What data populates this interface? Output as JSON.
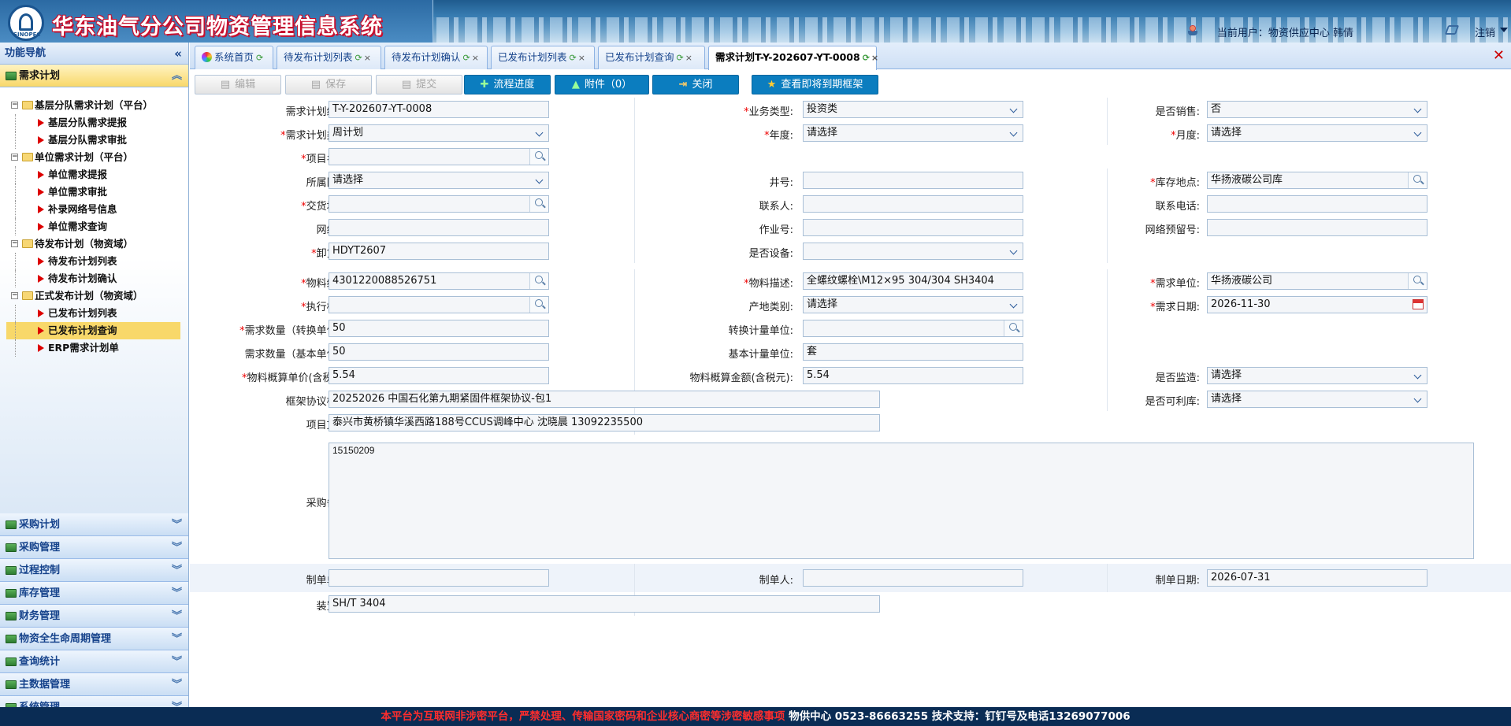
{
  "header": {
    "system_title": "华东油气分公司物资管理信息系统",
    "user_label": "当前用户：物资供应中心 韩倩",
    "logout_label": "注销",
    "logo_text": "SINOPEC"
  },
  "sidebar": {
    "title": "功能导航",
    "active_section": "需求计划",
    "tree": [
      {
        "type": "folder",
        "label": "基层分队需求计划（平台）"
      },
      {
        "type": "leaf",
        "label": "基层分队需求提报"
      },
      {
        "type": "leaf",
        "label": "基层分队需求审批"
      },
      {
        "type": "folder",
        "label": "单位需求计划（平台）"
      },
      {
        "type": "leaf",
        "label": "单位需求提报"
      },
      {
        "type": "leaf",
        "label": "单位需求审批"
      },
      {
        "type": "leaf",
        "label": "补录网络号信息"
      },
      {
        "type": "leaf",
        "label": "单位需求查询"
      },
      {
        "type": "folder",
        "label": "待发布计划（物资域）"
      },
      {
        "type": "leaf",
        "label": "待发布计划列表"
      },
      {
        "type": "leaf",
        "label": "待发布计划确认"
      },
      {
        "type": "folder",
        "label": "正式发布计划（物资域）"
      },
      {
        "type": "leaf",
        "label": "已发布计划列表"
      },
      {
        "type": "leaf",
        "label": "已发布计划查询",
        "selected": true
      },
      {
        "type": "leaf",
        "label": "ERP需求计划单"
      }
    ],
    "sections": [
      "采购计划",
      "采购管理",
      "过程控制",
      "库存管理",
      "财务管理",
      "物资全生命周期管理",
      "查询统计",
      "主数据管理",
      "系统管理"
    ]
  },
  "tabs": [
    {
      "label": "系统首页",
      "home": true
    },
    {
      "label": "待发布计划列表"
    },
    {
      "label": "待发布计划确认"
    },
    {
      "label": "已发布计划列表"
    },
    {
      "label": "已发布计划查询"
    },
    {
      "label": "需求计划T-Y-202607-YT-0008",
      "active": true
    }
  ],
  "toolbar": {
    "edit": "编辑",
    "save": "保存",
    "submit": "提交",
    "flow": "流程进度",
    "attach": "附件（0）",
    "close": "关闭",
    "expiring": "查看即将到期框架"
  },
  "form": {
    "plan_no": {
      "label": "需求计划编号:",
      "value": "T-Y-202607-YT-0008"
    },
    "biz_type": {
      "label": "业务类型:",
      "value": "投资类"
    },
    "is_sale": {
      "label": "是否销售:",
      "value": "否"
    },
    "plan_type": {
      "label": "需求计划类型:",
      "value": "周计划"
    },
    "year": {
      "label": "年度:",
      "value": "请选择"
    },
    "month": {
      "label": "月度:",
      "value": "请选择"
    },
    "project_name": {
      "label": "项目名称:",
      "value": ""
    },
    "region": {
      "label": "所属区域:",
      "value": "请选择"
    },
    "well_no": {
      "label": "井号:",
      "value": ""
    },
    "stock_loc": {
      "label": "库存地点:",
      "value": "华扬液碳公司库"
    },
    "delivery_addr": {
      "label": "交货地址:",
      "value": ""
    },
    "contact": {
      "label": "联系人:",
      "value": ""
    },
    "phone": {
      "label": "联系电话:",
      "value": ""
    },
    "network_no": {
      "label": "网络号:",
      "value": ""
    },
    "job_no": {
      "label": "作业号:",
      "value": ""
    },
    "net_reserve_no": {
      "label": "网络预留号:",
      "value": ""
    },
    "unload_point": {
      "label": "卸货点:",
      "value": "HDYT2607"
    },
    "is_equipment": {
      "label": "是否设备:",
      "value": ""
    },
    "material_code": {
      "label": "物料编码:",
      "value": "4301220088526751"
    },
    "material_desc": {
      "label": "物料描述:",
      "value": "全螺纹螺栓\\M12×95 304/304 SH3404"
    },
    "demand_unit": {
      "label": "需求单位:",
      "value": "华扬液碳公司"
    },
    "exec_standard": {
      "label": "执行标准:",
      "value": ""
    },
    "origin_type": {
      "label": "产地类别:",
      "value": "请选择"
    },
    "demand_date": {
      "label": "需求日期:",
      "value": "2026-11-30"
    },
    "qty_conv": {
      "label": "需求数量（转换单位）:",
      "value": "50"
    },
    "conv_unit": {
      "label": "转换计量单位:",
      "value": ""
    },
    "qty_base": {
      "label": "需求数量（基本单位）:",
      "value": "50"
    },
    "base_unit": {
      "label": "基本计量单位:",
      "value": "套"
    },
    "unit_price": {
      "label": "物料概算单价(含税元):",
      "value": "5.54"
    },
    "amount": {
      "label": "物料概算金额(含税元):",
      "value": "5.54"
    },
    "supervise": {
      "label": "是否监造:",
      "value": "请选择"
    },
    "framework": {
      "label": "框架协议标包:",
      "value": "20252026 中国石化第九期紧固件框架协议-包1"
    },
    "reusable": {
      "label": "是否可利库:",
      "value": "请选择"
    },
    "project_text": {
      "label": "项目文本:",
      "value": "泰兴市黄桥镇华溪西路188号CCUS调峰中心 沈晓晨 13092235500"
    },
    "purchase_note": {
      "label": "采购备注:",
      "value": "15150209"
    },
    "maker_unit": {
      "label": "制单单位:",
      "value": ""
    },
    "maker": {
      "label": "制单人:",
      "value": ""
    },
    "make_date": {
      "label": "制单日期:",
      "value": "2026-07-31"
    },
    "device_no": {
      "label": "装置号:",
      "value": "SH/T 3404"
    }
  },
  "footer": {
    "warning": "本平台为互联网非涉密平台，严禁处理、传输国家密码和企业核心商密等涉密敏感事项",
    "contact": " 物供中心 0523-86663255  技术支持：钉钉号及电话13269077006"
  }
}
